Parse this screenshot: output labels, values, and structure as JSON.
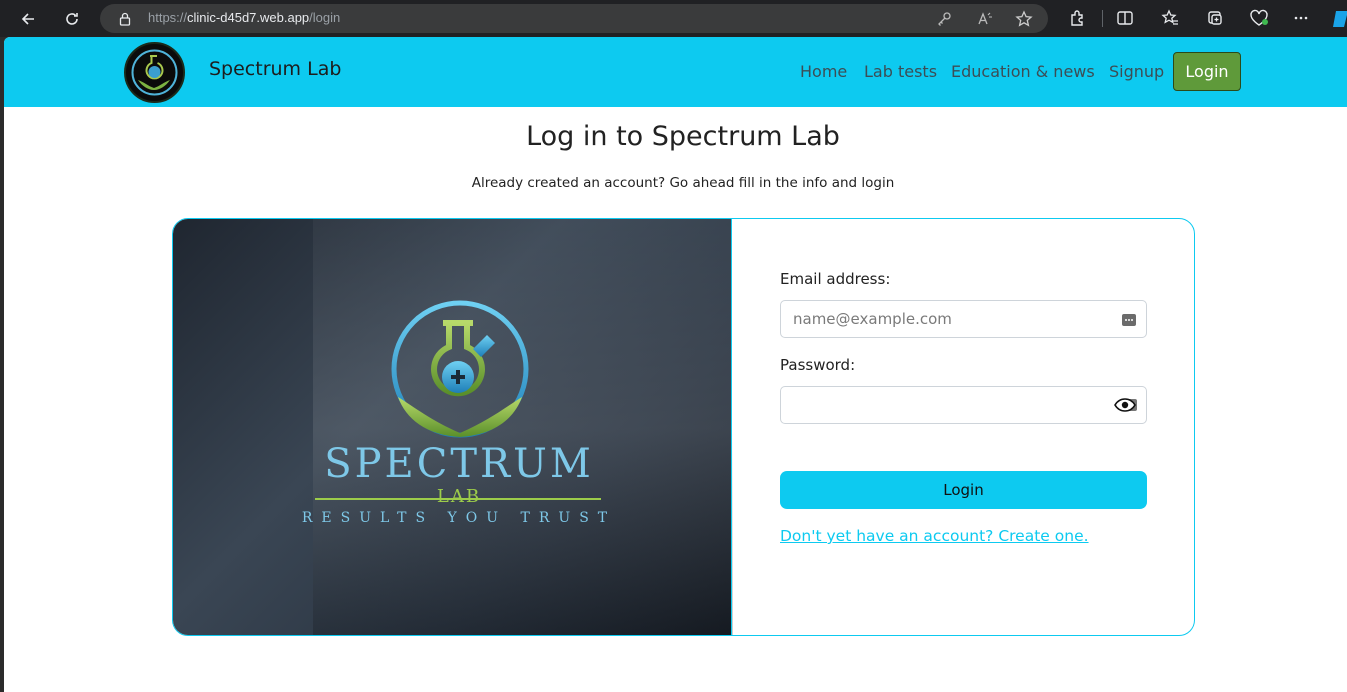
{
  "browser": {
    "url_prefix": "https://",
    "url_domain": "clinic-d45d7.web.app",
    "url_path": "/login"
  },
  "header": {
    "brand": "Spectrum Lab",
    "nav": [
      "Home",
      "Lab tests",
      "Education & news",
      "Signup"
    ],
    "login_label": "Login",
    "colors": {
      "bar": "#0dcaf0",
      "login_button": "#5f9a3a"
    }
  },
  "main": {
    "title": "Log in to Spectrum Lab",
    "subtitle": "Already created an account? Go ahead fill in the info and login"
  },
  "brand_image": {
    "name": "SPECTRUM",
    "sub": "LAB",
    "tagline": "RESULTS YOU TRUST"
  },
  "form": {
    "email_label": "Email address:",
    "email_placeholder": "name@example.com",
    "email_value": "",
    "password_label": "Password:",
    "password_value": "",
    "submit_label": "Login",
    "signup_link": "Don't yet have an account? Create one."
  }
}
